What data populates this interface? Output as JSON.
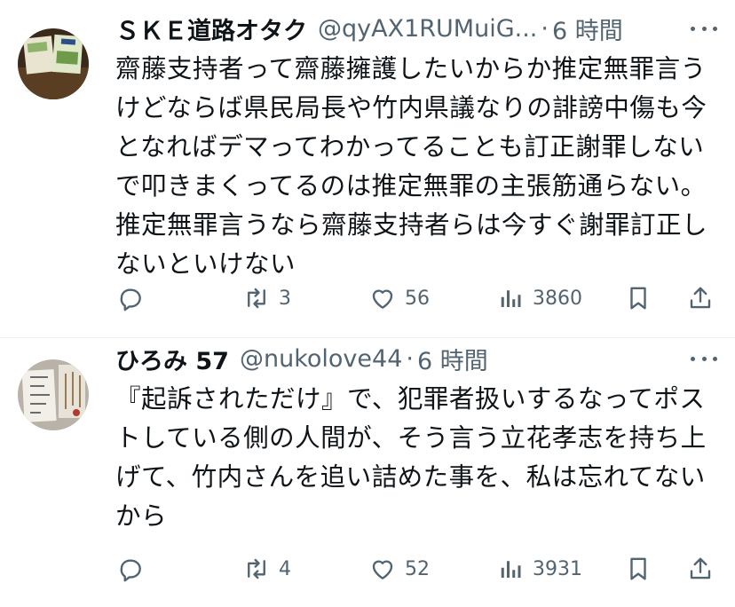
{
  "tweets": [
    {
      "name": "ＳＫＥ道路オタク",
      "handle": "@qyAX1RUMuiG...",
      "dot": "·",
      "time": "6 時間",
      "text": "齋藤支持者って齋藤擁護したいからか推定無罪言うけどならば県民局長や竹内県議なりの誹謗中傷も今となればデマってわかってることも訂正謝罪しないで叩きまくってるのは推定無罪の主張筋通らない。推定無罪言うなら齋藤支持者らは今すぐ謝罪訂正しないといけない",
      "replies": "",
      "retweets": "3",
      "likes": "56",
      "views": "3860"
    },
    {
      "name": "ひろみ 57",
      "handle": "@nukolove44",
      "dot": "·",
      "time": "6 時間",
      "text": "『起訴されただけ』で、犯罪者扱いするなってポストしている側の人間が、そう言う立花孝志を持ち上げて、竹内さんを追い詰めた事を、私は忘れてないから",
      "replies": "",
      "retweets": "4",
      "likes": "52",
      "views": "3931"
    }
  ],
  "icons": [
    "reply-icon",
    "retweet-icon",
    "like-icon",
    "views-icon",
    "bookmark-icon",
    "share-icon",
    "more-icon"
  ],
  "colors": {
    "text": "#0f1419",
    "secondary": "#536471",
    "divider": "#eff3f4"
  }
}
